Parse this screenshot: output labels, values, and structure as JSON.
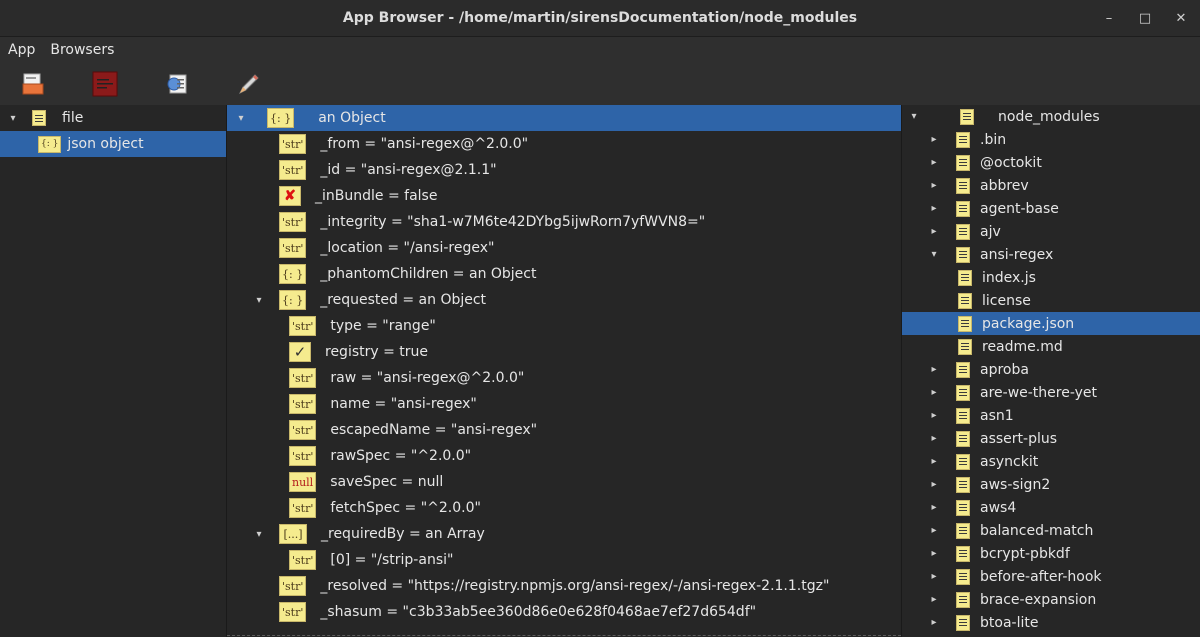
{
  "window": {
    "title": "App Browser - /home/martin/sirensDocumentation/node_modules",
    "controls": {
      "minimize": "–",
      "maximize": "□",
      "close": "✕"
    }
  },
  "menu": [
    "App",
    "Browsers"
  ],
  "toolbar": {
    "icons": [
      "open-file-icon",
      "terminal-icon",
      "inspect-icon",
      "pencil-icon"
    ]
  },
  "left_tree": {
    "items": [
      {
        "label": "file",
        "level": 0,
        "expanded": true,
        "selected": false
      },
      {
        "label": "json object",
        "level": 1,
        "selected": true
      }
    ],
    "badge": "{: }"
  },
  "inspector": {
    "rows": [
      {
        "badge": "{: }",
        "badge_kind": "obj",
        "text": "an Object",
        "indent": 0,
        "arrow": "▾",
        "selected": true
      },
      {
        "badge": "'str'",
        "badge_kind": "str",
        "text": "_from = \"ansi-regex@^2.0.0\"",
        "indent": 1
      },
      {
        "badge": "'str'",
        "badge_kind": "str",
        "text": "_id = \"ansi-regex@2.1.1\"",
        "indent": 1
      },
      {
        "badge": "✘",
        "badge_kind": "cross",
        "text": "_inBundle = false",
        "indent": 1
      },
      {
        "badge": "'str'",
        "badge_kind": "str",
        "text": "_integrity = \"sha1-w7M6te42DYbg5ijwRorn7yfWVN8=\"",
        "indent": 1
      },
      {
        "badge": "'str'",
        "badge_kind": "str",
        "text": "_location = \"/ansi-regex\"",
        "indent": 1
      },
      {
        "badge": "{: }",
        "badge_kind": "obj",
        "text": "_phantomChildren = an Object",
        "indent": 1
      },
      {
        "badge": "{: }",
        "badge_kind": "obj",
        "text": "_requested = an Object",
        "indent": 1,
        "arrow": "▾"
      },
      {
        "badge": "'str'",
        "badge_kind": "str",
        "text": "type = \"range\"",
        "indent": 2
      },
      {
        "badge": "✓",
        "badge_kind": "check",
        "text": "registry = true",
        "indent": 2
      },
      {
        "badge": "'str'",
        "badge_kind": "str",
        "text": "raw = \"ansi-regex@^2.0.0\"",
        "indent": 2
      },
      {
        "badge": "'str'",
        "badge_kind": "str",
        "text": "name = \"ansi-regex\"",
        "indent": 2
      },
      {
        "badge": "'str'",
        "badge_kind": "str",
        "text": "escapedName = \"ansi-regex\"",
        "indent": 2
      },
      {
        "badge": "'str'",
        "badge_kind": "str",
        "text": "rawSpec = \"^2.0.0\"",
        "indent": 2
      },
      {
        "badge": "null",
        "badge_kind": "null",
        "text": "saveSpec = null",
        "indent": 2
      },
      {
        "badge": "'str'",
        "badge_kind": "str",
        "text": "fetchSpec = \"^2.0.0\"",
        "indent": 2
      },
      {
        "badge": "[...]",
        "badge_kind": "arr",
        "text": "_requiredBy = an Array",
        "indent": 1,
        "arrow": "▾"
      },
      {
        "badge": "'str'",
        "badge_kind": "str",
        "text": "[0] = \"/strip-ansi\"",
        "indent": 2
      },
      {
        "badge": "'str'",
        "badge_kind": "str",
        "text": "_resolved = \"https://registry.npmjs.org/ansi-regex/-/ansi-regex-2.1.1.tgz\"",
        "indent": 1
      },
      {
        "badge": "'str'",
        "badge_kind": "str",
        "text": "_shasum = \"c3b33ab5ee360d86e0e628f0468ae7ef27d654df\"",
        "indent": 1
      }
    ]
  },
  "files": {
    "items": [
      {
        "label": "node_modules",
        "level": 0,
        "arrow": "▾"
      },
      {
        "label": ".bin",
        "level": 1,
        "arrow": "▸"
      },
      {
        "label": "@octokit",
        "level": 1,
        "arrow": "▸"
      },
      {
        "label": "abbrev",
        "level": 1,
        "arrow": "▸"
      },
      {
        "label": "agent-base",
        "level": 1,
        "arrow": "▸"
      },
      {
        "label": "ajv",
        "level": 1,
        "arrow": "▸"
      },
      {
        "label": "ansi-regex",
        "level": 1,
        "arrow": "▾"
      },
      {
        "label": "index.js",
        "level": 2,
        "file": true
      },
      {
        "label": "license",
        "level": 2,
        "file": true
      },
      {
        "label": "package.json",
        "level": 2,
        "file": true,
        "selected": true
      },
      {
        "label": "readme.md",
        "level": 2,
        "file": true
      },
      {
        "label": "aproba",
        "level": 1,
        "arrow": "▸"
      },
      {
        "label": "are-we-there-yet",
        "level": 1,
        "arrow": "▸"
      },
      {
        "label": "asn1",
        "level": 1,
        "arrow": "▸"
      },
      {
        "label": "assert-plus",
        "level": 1,
        "arrow": "▸"
      },
      {
        "label": "asynckit",
        "level": 1,
        "arrow": "▸"
      },
      {
        "label": "aws-sign2",
        "level": 1,
        "arrow": "▸"
      },
      {
        "label": "aws4",
        "level": 1,
        "arrow": "▸"
      },
      {
        "label": "balanced-match",
        "level": 1,
        "arrow": "▸"
      },
      {
        "label": "bcrypt-pbkdf",
        "level": 1,
        "arrow": "▸"
      },
      {
        "label": "before-after-hook",
        "level": 1,
        "arrow": "▸"
      },
      {
        "label": "brace-expansion",
        "level": 1,
        "arrow": "▸"
      },
      {
        "label": "btoa-lite",
        "level": 1,
        "arrow": "▸"
      }
    ]
  }
}
